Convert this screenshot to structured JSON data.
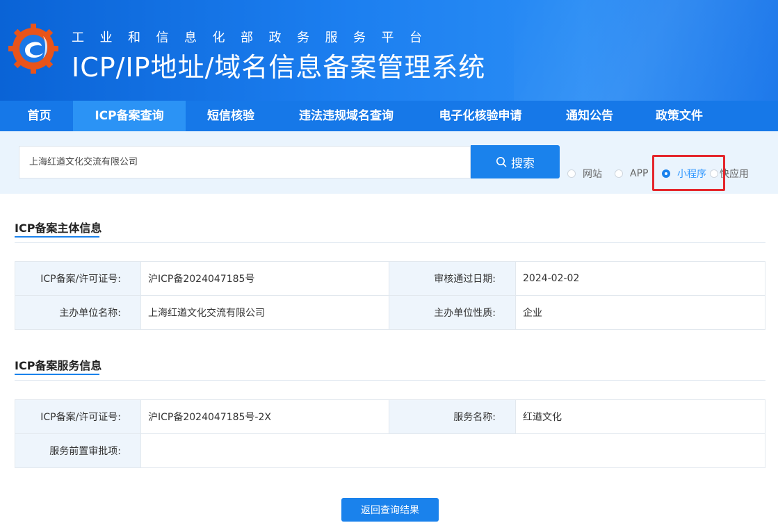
{
  "header": {
    "subtitle": "工业和信息化部政务服务平台",
    "title": "ICP/IP地址/域名信息备案管理系统"
  },
  "nav": {
    "items": [
      {
        "label": "首页",
        "active": false
      },
      {
        "label": "ICP备案查询",
        "active": true
      },
      {
        "label": "短信核验",
        "active": false
      },
      {
        "label": "违法违规域名查询",
        "active": false
      },
      {
        "label": "电子化核验申请",
        "active": false
      },
      {
        "label": "通知公告",
        "active": false
      },
      {
        "label": "政策文件",
        "active": false
      }
    ]
  },
  "search": {
    "value": "上海红遒文化交流有限公司",
    "button_label": "搜索",
    "types": [
      {
        "label": "网站",
        "checked": false
      },
      {
        "label": "APP",
        "checked": false
      },
      {
        "label": "小程序",
        "checked": true
      },
      {
        "label": "快应用",
        "checked": false
      }
    ]
  },
  "subject_section": {
    "title": "ICP备案主体信息",
    "rows": [
      {
        "label1": "ICP备案/许可证号:",
        "value1": "沪ICP备2024047185号",
        "label2": "审核通过日期:",
        "value2": "2024-02-02"
      },
      {
        "label1": "主办单位名称:",
        "value1": "上海红遒文化交流有限公司",
        "label2": "主办单位性质:",
        "value2": "企业"
      }
    ]
  },
  "service_section": {
    "title": "ICP备案服务信息",
    "rows": [
      {
        "label1": "ICP备案/许可证号:",
        "value1": "沪ICP备2024047185号-2X",
        "label2": "服务名称:",
        "value2": "红遒文化"
      },
      {
        "label1": "服务前置审批项:",
        "value1": ""
      }
    ]
  },
  "back_button": "返回查询结果",
  "colors": {
    "primary": "#1a82ec",
    "nav_bg": "#1678e8",
    "highlight": "#e4262c"
  }
}
